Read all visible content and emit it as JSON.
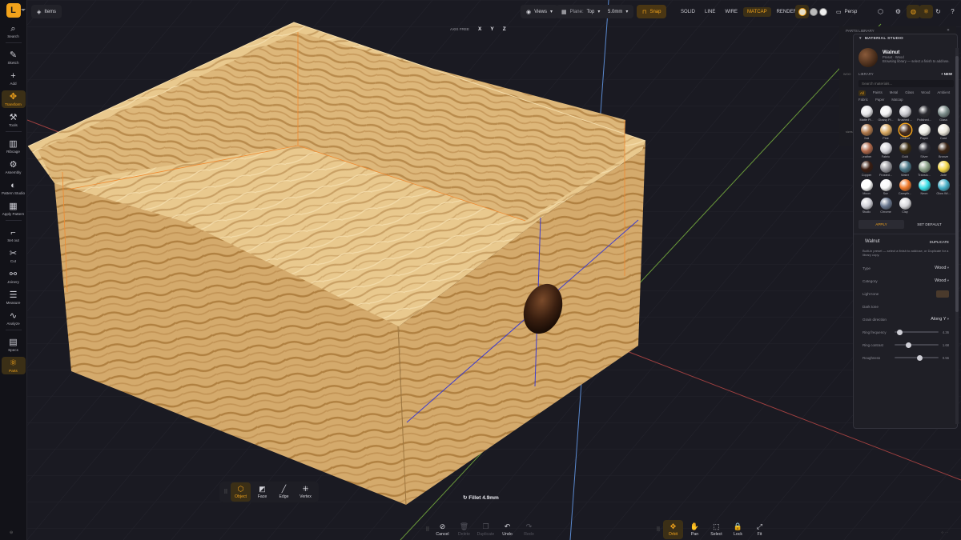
{
  "app": {
    "logo_letter": "L",
    "items_label": "Items"
  },
  "sidebar": {
    "items": [
      {
        "label": "Search",
        "icon": "search-icon",
        "glyph": "⌕"
      },
      {
        "label": "Sketch",
        "icon": "pencil-icon",
        "glyph": "✎"
      },
      {
        "label": "Add",
        "icon": "plus-icon",
        "glyph": "+"
      },
      {
        "label": "Transform",
        "icon": "move-icon",
        "glyph": "✥",
        "active": true
      },
      {
        "label": "Tools",
        "icon": "tools-icon",
        "glyph": "⚒"
      },
      {
        "label": "Ribcage",
        "icon": "ribcage-icon",
        "glyph": "▥"
      },
      {
        "label": "Assembly",
        "icon": "assembly-icon",
        "glyph": "⚙"
      },
      {
        "label": "Pattern Studio",
        "icon": "pattern-icon",
        "glyph": "◐"
      },
      {
        "label": "Apply Pattern",
        "icon": "apply-pattern-icon",
        "glyph": "▦"
      },
      {
        "label": "Set out",
        "icon": "set-out-icon",
        "glyph": "⌐"
      },
      {
        "label": "Cut",
        "icon": "scissors-icon",
        "glyph": "✂"
      },
      {
        "label": "Joinery",
        "icon": "joinery-icon",
        "glyph": "⚯"
      },
      {
        "label": "Measure",
        "icon": "ruler-icon",
        "glyph": "☰"
      },
      {
        "label": "Analyze",
        "icon": "analyze-icon",
        "glyph": "∿"
      },
      {
        "label": "Specs",
        "icon": "clipboard-icon",
        "glyph": "▤"
      },
      {
        "label": "Parts",
        "icon": "parts-icon",
        "glyph": "⚛",
        "active": true
      }
    ]
  },
  "topbar": {
    "views": "Views",
    "plane_label": "Plane:",
    "plane_value": "Top",
    "size": "5.0mm",
    "snap": "Snap",
    "modes": [
      "SOLID",
      "LINE",
      "WIRE",
      "MATCAP",
      "RENDER"
    ],
    "active_mode": "MATCAP",
    "persp": "Persp"
  },
  "axis_free": {
    "label": "AXIS FREE",
    "x": "X",
    "y": "Y",
    "z": "Z"
  },
  "parts_library": {
    "header": "PARTS LIBRARY",
    "woo_label": "WOO",
    "size_label": "sizes"
  },
  "material_studio": {
    "title": "MATERIAL STUDIO",
    "selected": {
      "name": "Walnut",
      "sub": "Preset · Wood",
      "hint": "Browsing library — select a finish to add/use."
    },
    "library_label": "LIBRARY",
    "new_label": "+ NEW",
    "search_placeholder": "Search materials...",
    "chips": [
      "All",
      "Paints",
      "Metal",
      "Glass",
      "Wood",
      "Ambient",
      "Fabric",
      "Paper",
      "Matcap"
    ],
    "active_chip": "All",
    "swatches": [
      {
        "label": "Matte Pl...",
        "color": "#e6e6ea"
      },
      {
        "label": "Glossy Pl...",
        "color": "#f2f2f5"
      },
      {
        "label": "Brushed ...",
        "color": "#c9c9cf"
      },
      {
        "label": "Polished...",
        "color": "#2a2a30"
      },
      {
        "label": "Glass",
        "color": "#7a8a88"
      },
      {
        "label": "Oak",
        "color": "#b0784a"
      },
      {
        "label": "Pine",
        "color": "#d8a860"
      },
      {
        "label": "Walnut",
        "color": "#4a2e1c",
        "selected": true
      },
      {
        "label": "Paper",
        "color": "#f0efe8"
      },
      {
        "label": "Card",
        "color": "#ece8dc"
      },
      {
        "label": "Leather",
        "color": "#b0684a"
      },
      {
        "label": "Fabric",
        "color": "#d4d4da"
      },
      {
        "label": "Gold",
        "color": "#3a2c10"
      },
      {
        "label": "Silver",
        "color": "#2c2c34"
      },
      {
        "label": "Bronze",
        "color": "#3a2414"
      },
      {
        "label": "Copper",
        "color": "#3a1c10"
      },
      {
        "label": "Frosted...",
        "color": "#9a9aa0"
      },
      {
        "label": "Water",
        "color": "#4a7888"
      },
      {
        "label": "Translu...",
        "color": "#8aa088"
      },
      {
        "label": "Jade",
        "color": "#f4d84a"
      },
      {
        "label": "Moon",
        "color": "#ffffff"
      },
      {
        "label": "Sun",
        "color": "#f8f8f8"
      },
      {
        "label": "Campfir...",
        "color": "#f07a2a"
      },
      {
        "label": "Neon",
        "color": "#3ae0e8"
      },
      {
        "label": "Glow Wi...",
        "color": "#48b0c8"
      },
      {
        "label": "Studio",
        "color": "#d0d0d8"
      },
      {
        "label": "Chrome",
        "color": "#6a7890"
      },
      {
        "label": "Clay",
        "color": "#d8d8dc"
      }
    ],
    "apply": "APPLY",
    "set_default": "SET DEFAULT",
    "editor": {
      "title": "Walnut",
      "duplicate": "DUPLICATE",
      "note": "Built-in preset — select a finish to add/use, or Duplicate for a library copy.",
      "type_label": "Type",
      "type_value": "Wood",
      "category_label": "Category",
      "category_value": "Wood",
      "light_tone": "Light tone",
      "light_tone_color": "#4a3a2c",
      "dark_tone": "Dark tone",
      "grain_label": "Grain direction",
      "grain_value": "Along Y",
      "sliders": [
        {
          "label": "Ring frequency",
          "value": "4.36",
          "fraction": 0.1
        },
        {
          "label": "Ring contrast",
          "value": "1.68",
          "fraction": 0.3
        },
        {
          "label": "Roughness",
          "value": "0.56",
          "fraction": 0.56
        }
      ]
    }
  },
  "select_toolbar": {
    "buttons": [
      {
        "label": "Object",
        "icon": "cube-icon",
        "glyph": "⬡",
        "active": true
      },
      {
        "label": "Face",
        "icon": "face-icon",
        "glyph": "◩"
      },
      {
        "label": "Edge",
        "icon": "edge-icon",
        "glyph": "╱"
      },
      {
        "label": "Vertex",
        "icon": "vertex-icon",
        "glyph": "⁜"
      }
    ]
  },
  "fillet_label": "↻ Fillet 4.9mm",
  "action_toolbar": {
    "buttons": [
      {
        "label": "Cancel",
        "icon": "cancel-icon",
        "glyph": "⊘"
      },
      {
        "label": "Delete",
        "icon": "trash-icon",
        "glyph": "🗑",
        "disabled": true
      },
      {
        "label": "Duplicate",
        "icon": "duplicate-icon",
        "glyph": "❐",
        "disabled": true
      },
      {
        "label": "Undo",
        "icon": "undo-icon",
        "glyph": "↶"
      },
      {
        "label": "Redo",
        "icon": "redo-icon",
        "glyph": "↷",
        "disabled": true
      }
    ]
  },
  "nav_toolbar": {
    "buttons": [
      {
        "label": "Orbit",
        "icon": "orbit-icon",
        "glyph": "✥",
        "active": true
      },
      {
        "label": "Pan",
        "icon": "hand-icon",
        "glyph": "✋"
      },
      {
        "label": "Select",
        "icon": "cursor-icon",
        "glyph": "⬚"
      },
      {
        "label": "Lock",
        "icon": "lock-icon",
        "glyph": "🔒"
      },
      {
        "label": "Fit",
        "icon": "fit-icon",
        "glyph": "⤢"
      }
    ]
  }
}
